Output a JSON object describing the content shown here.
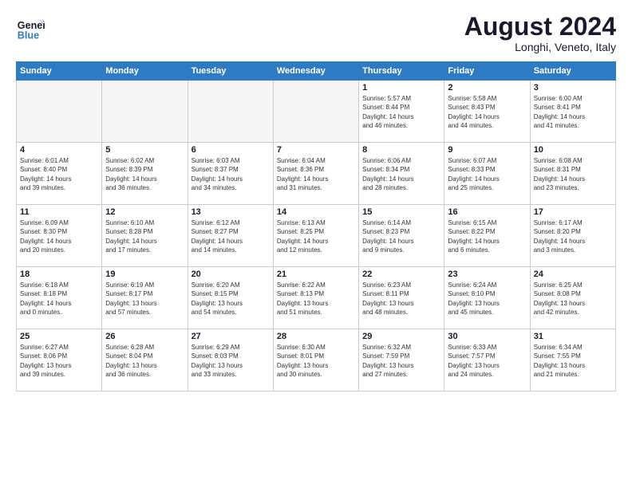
{
  "logo": {
    "line1": "General",
    "line2": "Blue"
  },
  "title": "August 2024",
  "subtitle": "Longhi, Veneto, Italy",
  "headers": [
    "Sunday",
    "Monday",
    "Tuesday",
    "Wednesday",
    "Thursday",
    "Friday",
    "Saturday"
  ],
  "weeks": [
    [
      {
        "day": "",
        "info": "",
        "empty": true
      },
      {
        "day": "",
        "info": "",
        "empty": true
      },
      {
        "day": "",
        "info": "",
        "empty": true
      },
      {
        "day": "",
        "info": "",
        "empty": true
      },
      {
        "day": "1",
        "info": "Sunrise: 5:57 AM\nSunset: 8:44 PM\nDaylight: 14 hours\nand 46 minutes."
      },
      {
        "day": "2",
        "info": "Sunrise: 5:58 AM\nSunset: 8:43 PM\nDaylight: 14 hours\nand 44 minutes."
      },
      {
        "day": "3",
        "info": "Sunrise: 6:00 AM\nSunset: 8:41 PM\nDaylight: 14 hours\nand 41 minutes."
      }
    ],
    [
      {
        "day": "4",
        "info": "Sunrise: 6:01 AM\nSunset: 8:40 PM\nDaylight: 14 hours\nand 39 minutes."
      },
      {
        "day": "5",
        "info": "Sunrise: 6:02 AM\nSunset: 8:39 PM\nDaylight: 14 hours\nand 36 minutes."
      },
      {
        "day": "6",
        "info": "Sunrise: 6:03 AM\nSunset: 8:37 PM\nDaylight: 14 hours\nand 34 minutes."
      },
      {
        "day": "7",
        "info": "Sunrise: 6:04 AM\nSunset: 8:36 PM\nDaylight: 14 hours\nand 31 minutes."
      },
      {
        "day": "8",
        "info": "Sunrise: 6:06 AM\nSunset: 8:34 PM\nDaylight: 14 hours\nand 28 minutes."
      },
      {
        "day": "9",
        "info": "Sunrise: 6:07 AM\nSunset: 8:33 PM\nDaylight: 14 hours\nand 25 minutes."
      },
      {
        "day": "10",
        "info": "Sunrise: 6:08 AM\nSunset: 8:31 PM\nDaylight: 14 hours\nand 23 minutes."
      }
    ],
    [
      {
        "day": "11",
        "info": "Sunrise: 6:09 AM\nSunset: 8:30 PM\nDaylight: 14 hours\nand 20 minutes."
      },
      {
        "day": "12",
        "info": "Sunrise: 6:10 AM\nSunset: 8:28 PM\nDaylight: 14 hours\nand 17 minutes."
      },
      {
        "day": "13",
        "info": "Sunrise: 6:12 AM\nSunset: 8:27 PM\nDaylight: 14 hours\nand 14 minutes."
      },
      {
        "day": "14",
        "info": "Sunrise: 6:13 AM\nSunset: 8:25 PM\nDaylight: 14 hours\nand 12 minutes."
      },
      {
        "day": "15",
        "info": "Sunrise: 6:14 AM\nSunset: 8:23 PM\nDaylight: 14 hours\nand 9 minutes."
      },
      {
        "day": "16",
        "info": "Sunrise: 6:15 AM\nSunset: 8:22 PM\nDaylight: 14 hours\nand 6 minutes."
      },
      {
        "day": "17",
        "info": "Sunrise: 6:17 AM\nSunset: 8:20 PM\nDaylight: 14 hours\nand 3 minutes."
      }
    ],
    [
      {
        "day": "18",
        "info": "Sunrise: 6:18 AM\nSunset: 8:18 PM\nDaylight: 14 hours\nand 0 minutes."
      },
      {
        "day": "19",
        "info": "Sunrise: 6:19 AM\nSunset: 8:17 PM\nDaylight: 13 hours\nand 57 minutes."
      },
      {
        "day": "20",
        "info": "Sunrise: 6:20 AM\nSunset: 8:15 PM\nDaylight: 13 hours\nand 54 minutes."
      },
      {
        "day": "21",
        "info": "Sunrise: 6:22 AM\nSunset: 8:13 PM\nDaylight: 13 hours\nand 51 minutes."
      },
      {
        "day": "22",
        "info": "Sunrise: 6:23 AM\nSunset: 8:11 PM\nDaylight: 13 hours\nand 48 minutes."
      },
      {
        "day": "23",
        "info": "Sunrise: 6:24 AM\nSunset: 8:10 PM\nDaylight: 13 hours\nand 45 minutes."
      },
      {
        "day": "24",
        "info": "Sunrise: 6:25 AM\nSunset: 8:08 PM\nDaylight: 13 hours\nand 42 minutes."
      }
    ],
    [
      {
        "day": "25",
        "info": "Sunrise: 6:27 AM\nSunset: 8:06 PM\nDaylight: 13 hours\nand 39 minutes."
      },
      {
        "day": "26",
        "info": "Sunrise: 6:28 AM\nSunset: 8:04 PM\nDaylight: 13 hours\nand 36 minutes."
      },
      {
        "day": "27",
        "info": "Sunrise: 6:29 AM\nSunset: 8:03 PM\nDaylight: 13 hours\nand 33 minutes."
      },
      {
        "day": "28",
        "info": "Sunrise: 6:30 AM\nSunset: 8:01 PM\nDaylight: 13 hours\nand 30 minutes."
      },
      {
        "day": "29",
        "info": "Sunrise: 6:32 AM\nSunset: 7:59 PM\nDaylight: 13 hours\nand 27 minutes."
      },
      {
        "day": "30",
        "info": "Sunrise: 6:33 AM\nSunset: 7:57 PM\nDaylight: 13 hours\nand 24 minutes."
      },
      {
        "day": "31",
        "info": "Sunrise: 6:34 AM\nSunset: 7:55 PM\nDaylight: 13 hours\nand 21 minutes."
      }
    ]
  ]
}
